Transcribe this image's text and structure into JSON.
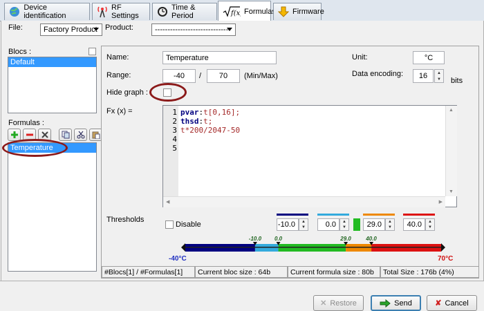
{
  "tabs": [
    {
      "label": "Device identification",
      "icon": "globe-icon"
    },
    {
      "label": "RF Settings",
      "icon": "antenna-icon"
    },
    {
      "label": "Time & Period",
      "icon": "clock-icon"
    },
    {
      "label": "Formulas",
      "icon": "sqrt-fx-icon",
      "active": true
    },
    {
      "label": "Firmware",
      "icon": "download-arrow-icon"
    }
  ],
  "top": {
    "file_label": "File:",
    "file_value": "Factory Product",
    "product_label": "Product:",
    "product_value": "------------------------------"
  },
  "blocs": {
    "label": "Blocs :",
    "items": [
      "Default"
    ]
  },
  "formulas": {
    "label": "Formulas :",
    "items": [
      "Temperature"
    ]
  },
  "form": {
    "name_label": "Name:",
    "name_value": "Temperature",
    "unit_label": "Unit:",
    "unit_value": "°C",
    "range_label": "Range:",
    "range_min": "-40",
    "range_sep": "/",
    "range_max": "70",
    "range_hint": "(Min/Max)",
    "encoding_label": "Data encoding:",
    "encoding_value": "16",
    "encoding_unit": "bits",
    "hide_graph_label": "Hide graph :",
    "fx_label": "Fx (x) ="
  },
  "code": {
    "lines": [
      {
        "n": "1",
        "parts": [
          {
            "t": "pvar",
            "c": "#000080",
            "b": true
          },
          {
            "t": ":",
            "c": "#000"
          },
          {
            "t": "t[0,16];",
            "c": "#a52a2a"
          }
        ]
      },
      {
        "n": "2",
        "parts": [
          {
            "t": "thsd",
            "c": "#000080",
            "b": true
          },
          {
            "t": ":",
            "c": "#000"
          },
          {
            "t": "t;",
            "c": "#a52a2a"
          }
        ]
      },
      {
        "n": "3",
        "parts": [
          {
            "t": "t*200/2047-50",
            "c": "#a52a2a"
          }
        ]
      },
      {
        "n": "4",
        "parts": []
      },
      {
        "n": "5",
        "parts": []
      }
    ]
  },
  "thresholds": {
    "label": "Thresholds",
    "disable_label": "Disable",
    "values": [
      "-10.0",
      "0.0",
      "29.0",
      "40.0"
    ],
    "colors": [
      "#000080",
      "#33aadd",
      "#22bb22",
      "#ee8800",
      "#dd1111"
    ],
    "scale_min": "-40°C",
    "scale_max": "70°C",
    "ticks": [
      "-10.0",
      "0.0",
      "29.0",
      "40.0"
    ]
  },
  "status": {
    "count": "#Blocs[1] / #Formulas[1]",
    "bloc_size": "Current bloc size : 64b",
    "formula_size": "Current formula size : 80b",
    "total": "Total Size : 176b (4%)"
  },
  "buttons": {
    "restore": "Restore",
    "send": "Send",
    "cancel": "Cancel"
  }
}
